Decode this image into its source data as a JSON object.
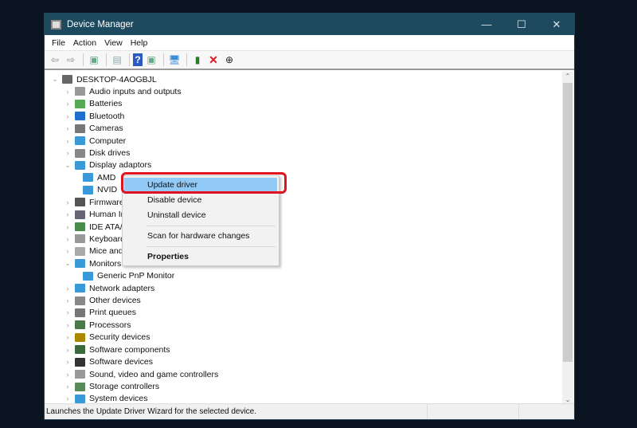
{
  "window": {
    "title": "Device Manager",
    "controls": [
      "—",
      "☐",
      "✕"
    ]
  },
  "menu": [
    "File",
    "Action",
    "View",
    "Help"
  ],
  "toolbar": [
    {
      "icon": "back-arrow-icon",
      "glyph": "⇦",
      "color": "#888"
    },
    {
      "icon": "forward-arrow-icon",
      "glyph": "⇨",
      "color": "#888"
    },
    {
      "sep": true
    },
    {
      "icon": "show-hide-console-tree-icon",
      "glyph": "▣",
      "color": "#6a8"
    },
    {
      "sep": true
    },
    {
      "icon": "properties-icon",
      "glyph": "▤",
      "color": "#8aa"
    },
    {
      "sep": true
    },
    {
      "icon": "help-icon",
      "glyph": "?",
      "color": "#2b59c3"
    },
    {
      "icon": "action-pane-icon",
      "glyph": "▣",
      "color": "#6a8"
    },
    {
      "sep": true
    },
    {
      "icon": "scan-hardware-icon",
      "glyph": "🖥",
      "color": "#3a8ed6"
    },
    {
      "sep": true
    },
    {
      "icon": "update-driver-icon",
      "glyph": "▮",
      "color": "#2a7a2a"
    },
    {
      "icon": "uninstall-device-icon",
      "glyph": "✕",
      "color": "#e0141e"
    },
    {
      "icon": "download-driver-icon",
      "glyph": "⊕",
      "color": "#222"
    }
  ],
  "tree": [
    {
      "label": "DESKTOP-4AOGBJL",
      "level": 0,
      "chev": "⌄",
      "color": "#666"
    },
    {
      "label": "Audio inputs and outputs",
      "level": 1,
      "chev": "›",
      "color": "#999"
    },
    {
      "label": "Batteries",
      "level": 1,
      "chev": "›",
      "color": "#5a5"
    },
    {
      "label": "Bluetooth",
      "level": 1,
      "chev": "›",
      "color": "#1e6fd0"
    },
    {
      "label": "Cameras",
      "level": 1,
      "chev": "›",
      "color": "#777"
    },
    {
      "label": "Computer",
      "level": 1,
      "chev": "›",
      "color": "#3a9ad9"
    },
    {
      "label": "Disk drives",
      "level": 1,
      "chev": "›",
      "color": "#888"
    },
    {
      "label": "Display adaptors",
      "level": 1,
      "chev": "⌄",
      "color": "#3a9ad9"
    },
    {
      "label": "AMD",
      "level": 2,
      "chev": "",
      "color": "#3a9ad9"
    },
    {
      "label": "NVID",
      "level": 2,
      "chev": "",
      "color": "#3a9ad9"
    },
    {
      "label": "Firmware",
      "level": 1,
      "chev": "›",
      "color": "#555"
    },
    {
      "label": "Human In",
      "level": 1,
      "chev": "›",
      "color": "#667"
    },
    {
      "label": "IDE ATA/AT",
      "level": 1,
      "chev": "›",
      "color": "#4a8a4a"
    },
    {
      "label": "Keyboards",
      "level": 1,
      "chev": "›",
      "color": "#999"
    },
    {
      "label": "Mice and",
      "level": 1,
      "chev": "›",
      "color": "#aaa"
    },
    {
      "label": "Monitors",
      "level": 1,
      "chev": "⌄",
      "color": "#3a9ad9"
    },
    {
      "label": "Generic PnP Monitor",
      "level": 2,
      "chev": "",
      "color": "#3a9ad9"
    },
    {
      "label": "Network adapters",
      "level": 1,
      "chev": "›",
      "color": "#3a9ad9"
    },
    {
      "label": "Other devices",
      "level": 1,
      "chev": "›",
      "color": "#888"
    },
    {
      "label": "Print queues",
      "level": 1,
      "chev": "›",
      "color": "#777"
    },
    {
      "label": "Processors",
      "level": 1,
      "chev": "›",
      "color": "#4a7a4a"
    },
    {
      "label": "Security devices",
      "level": 1,
      "chev": "›",
      "color": "#a80"
    },
    {
      "label": "Software components",
      "level": 1,
      "chev": "›",
      "color": "#3a6a3a"
    },
    {
      "label": "Software devices",
      "level": 1,
      "chev": "›",
      "color": "#333"
    },
    {
      "label": "Sound, video and game controllers",
      "level": 1,
      "chev": "›",
      "color": "#999"
    },
    {
      "label": "Storage controllers",
      "level": 1,
      "chev": "›",
      "color": "#5a8a5a"
    },
    {
      "label": "System devices",
      "level": 1,
      "chev": "›",
      "color": "#3a9ad9"
    }
  ],
  "context_menu": {
    "items": [
      {
        "label": "Update driver",
        "highlighted": true
      },
      {
        "label": "Disable device"
      },
      {
        "label": "Uninstall device"
      },
      {
        "sep": true
      },
      {
        "label": "Scan for hardware changes"
      },
      {
        "sep": true
      },
      {
        "label": "Properties",
        "bold": true
      }
    ],
    "highlight_color": "#e0141e"
  },
  "status": {
    "text": "Launches the Update Driver Wizard for the selected device."
  }
}
